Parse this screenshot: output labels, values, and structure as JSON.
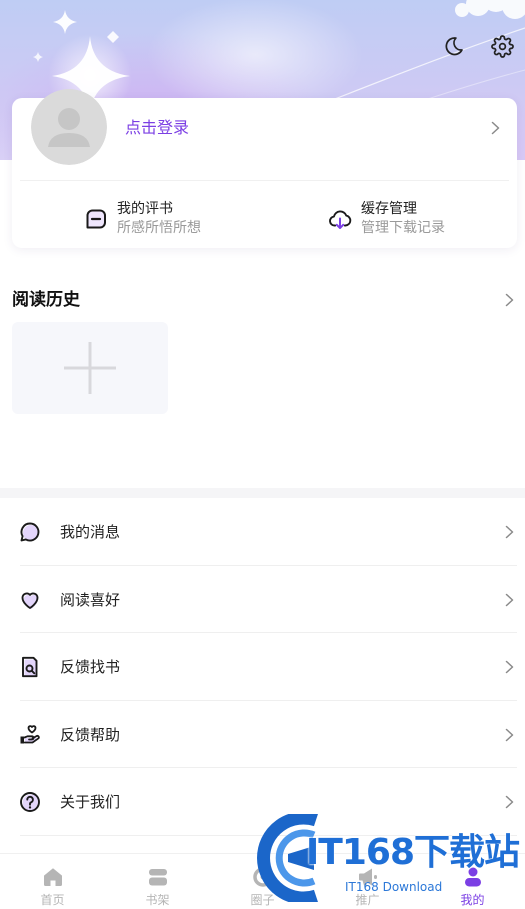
{
  "header": {
    "night_mode_icon": "moon-icon",
    "settings_icon": "gear-icon"
  },
  "profile": {
    "avatar_icon": "default-avatar-icon",
    "login_label": "点击登录",
    "shortcuts": [
      {
        "title": "我的评书",
        "subtitle": "所感所悟所想",
        "icon": "comment-icon"
      },
      {
        "title": "缓存管理",
        "subtitle": "管理下载记录",
        "icon": "cloud-download-icon"
      }
    ]
  },
  "history": {
    "title": "阅读历史",
    "add_icon": "plus-icon"
  },
  "menu": [
    {
      "label": "我的消息",
      "icon": "message-icon"
    },
    {
      "label": "阅读喜好",
      "icon": "heart-icon"
    },
    {
      "label": "反馈找书",
      "icon": "search-book-icon"
    },
    {
      "label": "反馈帮助",
      "icon": "help-hand-icon"
    },
    {
      "label": "关于我们",
      "icon": "question-icon"
    }
  ],
  "tabbar": {
    "active_index": 4,
    "items": [
      {
        "label": "首页",
        "icon": "home-icon"
      },
      {
        "label": "书架",
        "icon": "bookshelf-icon"
      },
      {
        "label": "圈子",
        "icon": "community-icon"
      },
      {
        "label": "推广",
        "icon": "promote-icon"
      },
      {
        "label": "我的",
        "icon": "profile-icon"
      }
    ]
  },
  "watermark": {
    "brand": "IT168下载站",
    "tagline": "IT168 Download"
  },
  "colors": {
    "accent": "#7b3fe4",
    "text": "#222222",
    "muted": "#9a9a9a",
    "tab_inactive": "#b5b5b5",
    "watermark": "#1f6fd6"
  }
}
